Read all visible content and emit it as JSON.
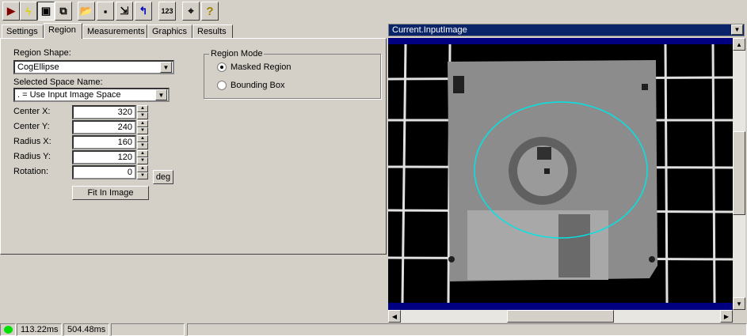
{
  "toolbar": {
    "buttons": [
      {
        "icon": "run-icon"
      },
      {
        "icon": "lightning-icon"
      },
      {
        "icon": "show-image-icon"
      },
      {
        "icon": "float-window-icon"
      },
      {
        "icon": "open-folder-icon"
      },
      {
        "icon": "save-icon"
      },
      {
        "icon": "save-as-icon"
      },
      {
        "icon": "reset-icon"
      },
      {
        "icon": "numeric-display-icon",
        "text": "123"
      },
      {
        "icon": "tool-properties-icon"
      },
      {
        "icon": "help-icon",
        "text": "?"
      }
    ]
  },
  "tabs": [
    "Settings",
    "Region",
    "Measurements",
    "Graphics",
    "Results"
  ],
  "active_tab": "Region",
  "region": {
    "shape_label": "Region Shape:",
    "shape_value": "CogEllipse",
    "space_label": "Selected Space Name:",
    "space_value": ". = Use Input Image Space",
    "fields": [
      {
        "label": "Center X:",
        "value": "320"
      },
      {
        "label": "Center Y:",
        "value": "240"
      },
      {
        "label": "Radius X:",
        "value": "160"
      },
      {
        "label": "Radius Y:",
        "value": "120"
      },
      {
        "label": "Rotation:",
        "value": "0"
      }
    ],
    "deg_label": "deg",
    "fit_label": "Fit In Image",
    "mode_title": "Region Mode",
    "mode_options": [
      "Masked Region",
      "Bounding Box"
    ],
    "mode_selected": "Masked Region"
  },
  "image": {
    "selector": "Current.InputImage",
    "ellipse_color": "#00e5e5"
  },
  "status": {
    "indicator_color": "#00e000",
    "time1": "113.22ms",
    "time2": "504.48ms"
  }
}
